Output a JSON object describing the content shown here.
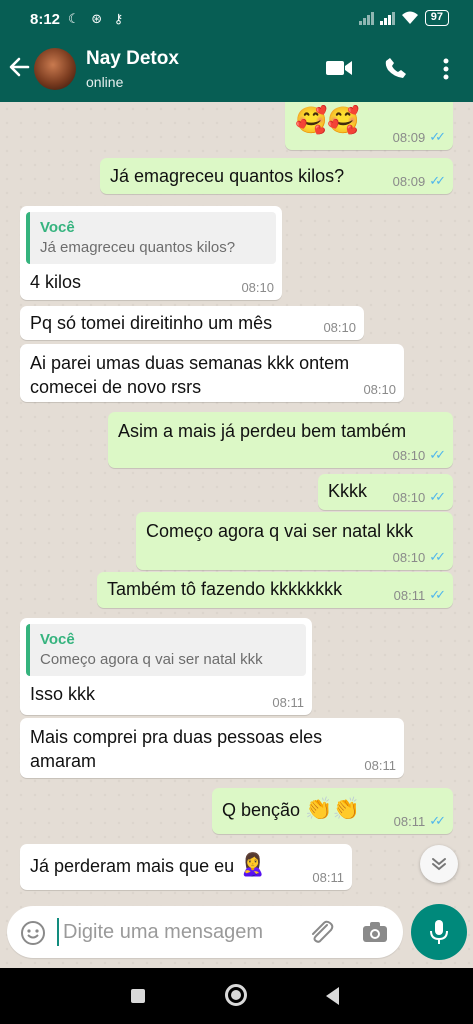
{
  "status_bar": {
    "time": "8:12",
    "left_icons": "☾ ⊛ ⚷",
    "battery": "97"
  },
  "header": {
    "contact_name": "Nay Detox",
    "contact_status": "online"
  },
  "messages": [
    {
      "text": "🥰🥰",
      "time": "08:09"
    },
    {
      "text": "Já emagreceu quantos kilos?",
      "time": "08:09"
    },
    {
      "quote_author": "Você",
      "quote_text": "Já emagreceu quantos kilos?",
      "text": "4 kilos",
      "time": "08:10"
    },
    {
      "text": "Pq só tomei direitinho um mês",
      "time": "08:10"
    },
    {
      "line1": "Ai parei umas duas semanas kkk ontem",
      "line2": "comecei de novo rsrs",
      "time": "08:10"
    },
    {
      "text": "Asim a mais já perdeu bem também",
      "time": "08:10"
    },
    {
      "text": "Kkkk",
      "time": "08:10"
    },
    {
      "text": "Começo agora q vai ser natal kkk",
      "time": "08:10"
    },
    {
      "text": "Também tô fazendo kkkkkkkk",
      "time": "08:11"
    },
    {
      "quote_author": "Você",
      "quote_text": "Começo agora q vai ser natal kkk",
      "text": "Isso kkk",
      "time": "08:11"
    },
    {
      "line1": "Mais comprei pra duas pessoas eles",
      "line2": "amaram",
      "time": "08:11"
    },
    {
      "text": "Q benção",
      "emoji": "👏👏",
      "time": "08:11"
    },
    {
      "text": "Já perderam mais que eu",
      "emoji": "🙎‍♀️",
      "time": "08:11"
    }
  ],
  "input": {
    "placeholder": "Digite uma mensagem"
  },
  "icons": {
    "back": "back-arrow-icon",
    "video": "video-call-icon",
    "call": "phone-icon",
    "menu": "more-vert-icon",
    "emoji": "emoji-icon",
    "attach": "paperclip-icon",
    "camera": "camera-icon",
    "mic": "mic-icon",
    "scroll": "chevron-double-down-icon"
  },
  "colors": {
    "header": "#075e54",
    "outgoing": "#dcf8c6",
    "incoming": "#ffffff",
    "read_ticks": "#4fb6ec",
    "accent": "#00897b"
  }
}
